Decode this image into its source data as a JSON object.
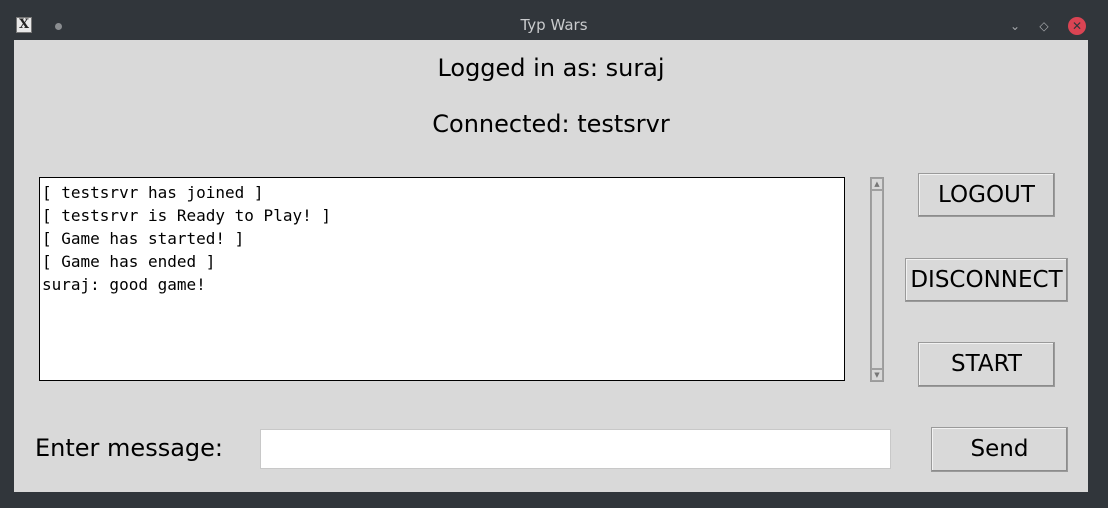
{
  "window": {
    "title": "Typ Wars",
    "app_icon_glyph": "X",
    "minimize_glyph": "⌄",
    "maximize_glyph": "◇",
    "close_glyph": "✕"
  },
  "status": {
    "logged_in": "Logged in as: suraj",
    "connected": "Connected: testsrvr"
  },
  "chat": {
    "lines": [
      "[ testsrvr has joined ]",
      "[ testsrvr is Ready to Play! ]",
      "[ Game has started! ]",
      "[ Game has ended ]",
      "suraj: good game!"
    ]
  },
  "buttons": {
    "logout": "LOGOUT",
    "disconnect": "DISCONNECT",
    "start": "START",
    "send": "Send"
  },
  "message": {
    "label": "Enter message:",
    "value": "",
    "placeholder": ""
  },
  "scrollbar": {
    "up_glyph": "▲",
    "down_glyph": "▼"
  },
  "colors": {
    "client_bg": "#d9d9d9",
    "titlebar_bg": "#31363b",
    "close_button": "#da4453"
  }
}
